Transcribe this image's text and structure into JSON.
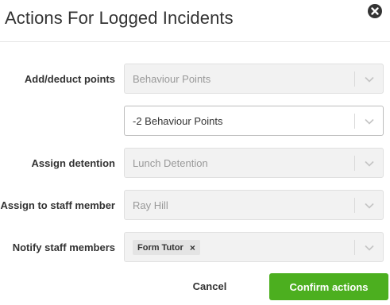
{
  "modal": {
    "title": "Actions For Logged Incidents"
  },
  "fields": {
    "points_label": "Add/deduct points",
    "points_type": "Behaviour Points",
    "points_amount": "-2 Behaviour Points",
    "detention_label": "Assign detention",
    "detention_value": "Lunch Detention",
    "staff_label": "Assign to staff member",
    "staff_value": "Ray Hill",
    "notify_label": "Notify staff members",
    "notify_tags": [
      "Form Tutor"
    ],
    "tag_remove_glyph": "×"
  },
  "footer": {
    "cancel_label": "Cancel",
    "confirm_label": "Confirm actions"
  },
  "colors": {
    "confirm_button": "#4caf1f",
    "disabled_field": "#f2f2f2"
  },
  "icons": {
    "close": "close-icon",
    "dropdown": "chevron-down-icon"
  }
}
